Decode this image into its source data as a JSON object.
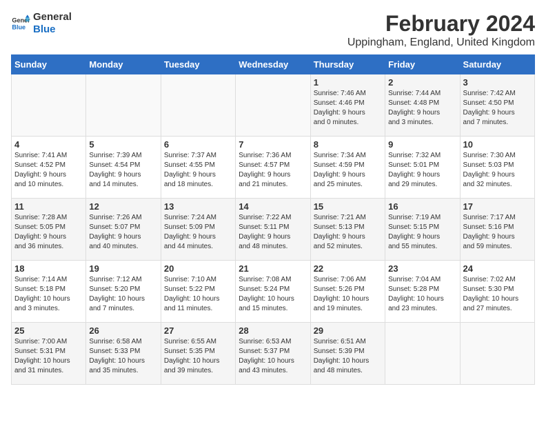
{
  "logo": {
    "line1": "General",
    "line2": "Blue"
  },
  "title": "February 2024",
  "subtitle": "Uppingham, England, United Kingdom",
  "days_of_week": [
    "Sunday",
    "Monday",
    "Tuesday",
    "Wednesday",
    "Thursday",
    "Friday",
    "Saturday"
  ],
  "weeks": [
    [
      {
        "day": "",
        "info": ""
      },
      {
        "day": "",
        "info": ""
      },
      {
        "day": "",
        "info": ""
      },
      {
        "day": "",
        "info": ""
      },
      {
        "day": "1",
        "info": "Sunrise: 7:46 AM\nSunset: 4:46 PM\nDaylight: 9 hours\nand 0 minutes."
      },
      {
        "day": "2",
        "info": "Sunrise: 7:44 AM\nSunset: 4:48 PM\nDaylight: 9 hours\nand 3 minutes."
      },
      {
        "day": "3",
        "info": "Sunrise: 7:42 AM\nSunset: 4:50 PM\nDaylight: 9 hours\nand 7 minutes."
      }
    ],
    [
      {
        "day": "4",
        "info": "Sunrise: 7:41 AM\nSunset: 4:52 PM\nDaylight: 9 hours\nand 10 minutes."
      },
      {
        "day": "5",
        "info": "Sunrise: 7:39 AM\nSunset: 4:54 PM\nDaylight: 9 hours\nand 14 minutes."
      },
      {
        "day": "6",
        "info": "Sunrise: 7:37 AM\nSunset: 4:55 PM\nDaylight: 9 hours\nand 18 minutes."
      },
      {
        "day": "7",
        "info": "Sunrise: 7:36 AM\nSunset: 4:57 PM\nDaylight: 9 hours\nand 21 minutes."
      },
      {
        "day": "8",
        "info": "Sunrise: 7:34 AM\nSunset: 4:59 PM\nDaylight: 9 hours\nand 25 minutes."
      },
      {
        "day": "9",
        "info": "Sunrise: 7:32 AM\nSunset: 5:01 PM\nDaylight: 9 hours\nand 29 minutes."
      },
      {
        "day": "10",
        "info": "Sunrise: 7:30 AM\nSunset: 5:03 PM\nDaylight: 9 hours\nand 32 minutes."
      }
    ],
    [
      {
        "day": "11",
        "info": "Sunrise: 7:28 AM\nSunset: 5:05 PM\nDaylight: 9 hours\nand 36 minutes."
      },
      {
        "day": "12",
        "info": "Sunrise: 7:26 AM\nSunset: 5:07 PM\nDaylight: 9 hours\nand 40 minutes."
      },
      {
        "day": "13",
        "info": "Sunrise: 7:24 AM\nSunset: 5:09 PM\nDaylight: 9 hours\nand 44 minutes."
      },
      {
        "day": "14",
        "info": "Sunrise: 7:22 AM\nSunset: 5:11 PM\nDaylight: 9 hours\nand 48 minutes."
      },
      {
        "day": "15",
        "info": "Sunrise: 7:21 AM\nSunset: 5:13 PM\nDaylight: 9 hours\nand 52 minutes."
      },
      {
        "day": "16",
        "info": "Sunrise: 7:19 AM\nSunset: 5:15 PM\nDaylight: 9 hours\nand 55 minutes."
      },
      {
        "day": "17",
        "info": "Sunrise: 7:17 AM\nSunset: 5:16 PM\nDaylight: 9 hours\nand 59 minutes."
      }
    ],
    [
      {
        "day": "18",
        "info": "Sunrise: 7:14 AM\nSunset: 5:18 PM\nDaylight: 10 hours\nand 3 minutes."
      },
      {
        "day": "19",
        "info": "Sunrise: 7:12 AM\nSunset: 5:20 PM\nDaylight: 10 hours\nand 7 minutes."
      },
      {
        "day": "20",
        "info": "Sunrise: 7:10 AM\nSunset: 5:22 PM\nDaylight: 10 hours\nand 11 minutes."
      },
      {
        "day": "21",
        "info": "Sunrise: 7:08 AM\nSunset: 5:24 PM\nDaylight: 10 hours\nand 15 minutes."
      },
      {
        "day": "22",
        "info": "Sunrise: 7:06 AM\nSunset: 5:26 PM\nDaylight: 10 hours\nand 19 minutes."
      },
      {
        "day": "23",
        "info": "Sunrise: 7:04 AM\nSunset: 5:28 PM\nDaylight: 10 hours\nand 23 minutes."
      },
      {
        "day": "24",
        "info": "Sunrise: 7:02 AM\nSunset: 5:30 PM\nDaylight: 10 hours\nand 27 minutes."
      }
    ],
    [
      {
        "day": "25",
        "info": "Sunrise: 7:00 AM\nSunset: 5:31 PM\nDaylight: 10 hours\nand 31 minutes."
      },
      {
        "day": "26",
        "info": "Sunrise: 6:58 AM\nSunset: 5:33 PM\nDaylight: 10 hours\nand 35 minutes."
      },
      {
        "day": "27",
        "info": "Sunrise: 6:55 AM\nSunset: 5:35 PM\nDaylight: 10 hours\nand 39 minutes."
      },
      {
        "day": "28",
        "info": "Sunrise: 6:53 AM\nSunset: 5:37 PM\nDaylight: 10 hours\nand 43 minutes."
      },
      {
        "day": "29",
        "info": "Sunrise: 6:51 AM\nSunset: 5:39 PM\nDaylight: 10 hours\nand 48 minutes."
      },
      {
        "day": "",
        "info": ""
      },
      {
        "day": "",
        "info": ""
      }
    ]
  ]
}
